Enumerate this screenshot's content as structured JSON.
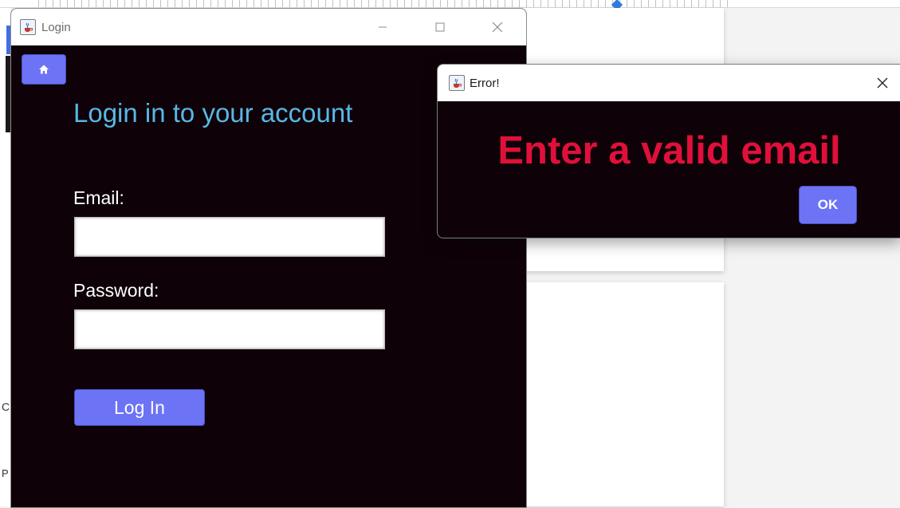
{
  "login_window": {
    "title": "Login",
    "icon": "java-coffee-icon",
    "heading": "Login in to your account",
    "email_label": "Email:",
    "email_value": "",
    "password_label": "Password:",
    "password_value": "",
    "login_button": "Log In",
    "home_icon": "home-icon",
    "colors": {
      "background": "#0e0208",
      "accent": "#6d73f5",
      "heading": "#58b7e6"
    }
  },
  "error_dialog": {
    "title": "Error!",
    "icon": "java-coffee-icon",
    "message": "Enter a valid email",
    "ok_button": "OK",
    "colors": {
      "message": "#e0103a"
    }
  }
}
